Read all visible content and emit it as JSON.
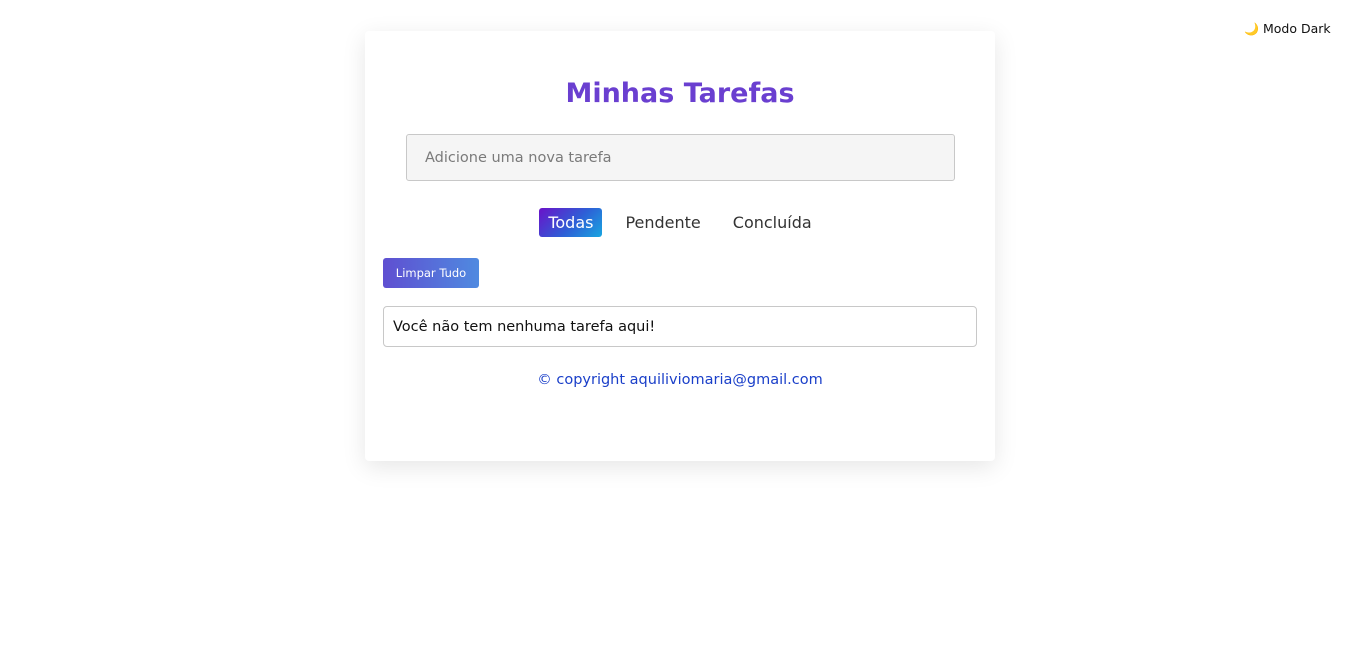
{
  "theme_toggle": {
    "icon": "moon-icon",
    "glyph": "🌙",
    "label": "Modo Dark"
  },
  "app": {
    "title": "Minhas Tarefas",
    "input": {
      "value": "",
      "placeholder": "Adicione uma nova tarefa"
    },
    "filters": [
      {
        "label": "Todas",
        "active": true
      },
      {
        "label": "Pendente",
        "active": false
      },
      {
        "label": "Concluída",
        "active": false
      }
    ],
    "clear_button_label": "Limpar Tudo",
    "empty_message": "Você não tem nenhuma tarefa aqui!",
    "footer": "© copyright aquiliviomaria@gmail.com"
  },
  "colors": {
    "title": "#6a3fd0",
    "footer_link": "#1a3fc9",
    "active_filter_gradient": [
      "#6a12c9",
      "#18a6e0"
    ],
    "clear_button_gradient": [
      "#5f4fd1",
      "#4f8ae0"
    ]
  }
}
